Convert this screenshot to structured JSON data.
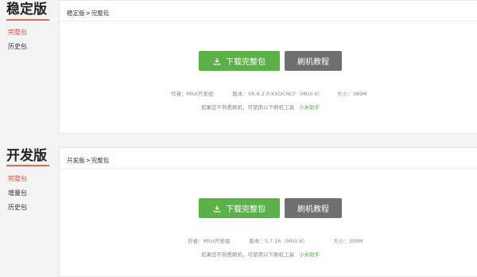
{
  "stable": {
    "title": "稳定版",
    "nav": [
      "完整包",
      "历史包"
    ],
    "breadcrumb": {
      "root": "稳定版",
      "sep": ">",
      "current": "完整包"
    },
    "download_label": "下载完整包",
    "guide_label": "刷机教程",
    "author": "作者：MIUI开发组",
    "version": "版本：V6.6.2.0.KXDCNCF（MIUI 6）",
    "size": "大小：389M",
    "hint": "如果您不熟悉刷机，可使用以下刷机工具",
    "tool_link": "小米助手"
  },
  "dev": {
    "title": "开发版",
    "nav": [
      "完整包",
      "增量包",
      "历史包"
    ],
    "breadcrumb": {
      "root": "开发版",
      "sep": ">",
      "current": "完整包"
    },
    "download_label": "下载完整包",
    "guide_label": "刷机教程",
    "author": "作者：MIUI开发组",
    "version": "版本：5.7.16（MIUI 6）",
    "size": "大小：399M",
    "hint": "如果您不熟悉刷机，可使用以下刷机工具",
    "tool_link": "小米助手"
  },
  "colors": {
    "accent": "#5bb048",
    "nav_active": "#e5533d",
    "underline": "#e56c4f",
    "guide_button": "#6f6f6f"
  },
  "icons": {
    "download": "download-icon"
  }
}
